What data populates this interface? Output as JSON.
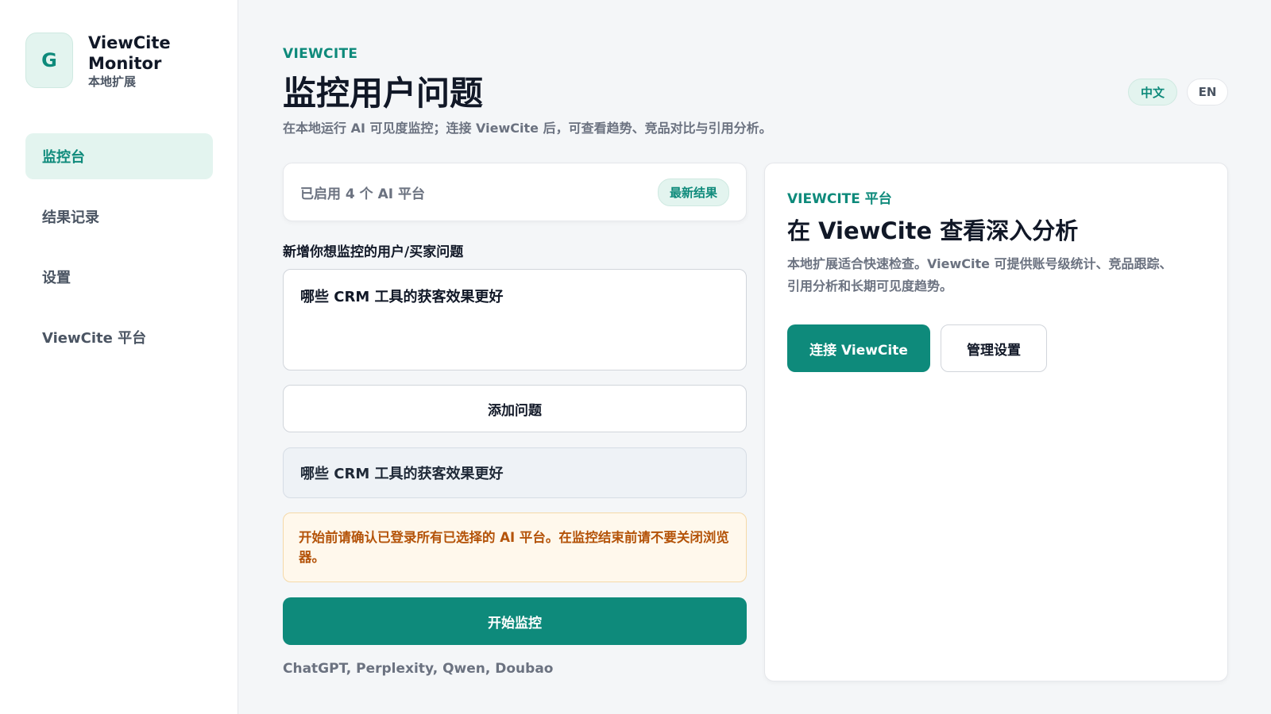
{
  "brand": {
    "logo_letter": "G",
    "name": "ViewCite Monitor",
    "subtitle": "本地扩展"
  },
  "sidebar": {
    "items": [
      {
        "label": "监控台",
        "active": true
      },
      {
        "label": "结果记录",
        "active": false
      },
      {
        "label": "设置",
        "active": false
      },
      {
        "label": "ViewCite 平台",
        "active": false
      }
    ]
  },
  "header": {
    "eyebrow": "VIEWCITE",
    "title": "监控用户问题",
    "subtitle": "在本地运行 AI 可见度监控；连接 ViewCite 后，可查看趋势、竞品对比与引用分析。",
    "lang_zh": "中文",
    "lang_en": "EN"
  },
  "status": {
    "text": "已启用 4 个 AI 平台",
    "badge": "最新结果"
  },
  "form": {
    "label": "新增你想监控的用户/买家问题",
    "value": "哪些 CRM 工具的获客效果更好",
    "add_button": "添加问题"
  },
  "questions": [
    "哪些 CRM 工具的获客效果更好"
  ],
  "warning": "开始前请确认已登录所有已选择的 AI 平台。在监控结束前请不要关闭浏览器。",
  "start_button": "开始监控",
  "platforms": "ChatGPT, Perplexity, Qwen, Doubao",
  "promo": {
    "eyebrow": "VIEWCITE 平台",
    "title": "在 ViewCite 查看深入分析",
    "description": "本地扩展适合快速检查。ViewCite 可提供账号级统计、竞品跟踪、引用分析和长期可见度趋势。",
    "connect_button": "连接 ViewCite",
    "manage_button": "管理设置"
  },
  "colors": {
    "accent": "#0e8a7b",
    "accent_soft": "#e3f4ef",
    "warning_text": "#b45309",
    "warning_bg": "#fff8ec"
  }
}
